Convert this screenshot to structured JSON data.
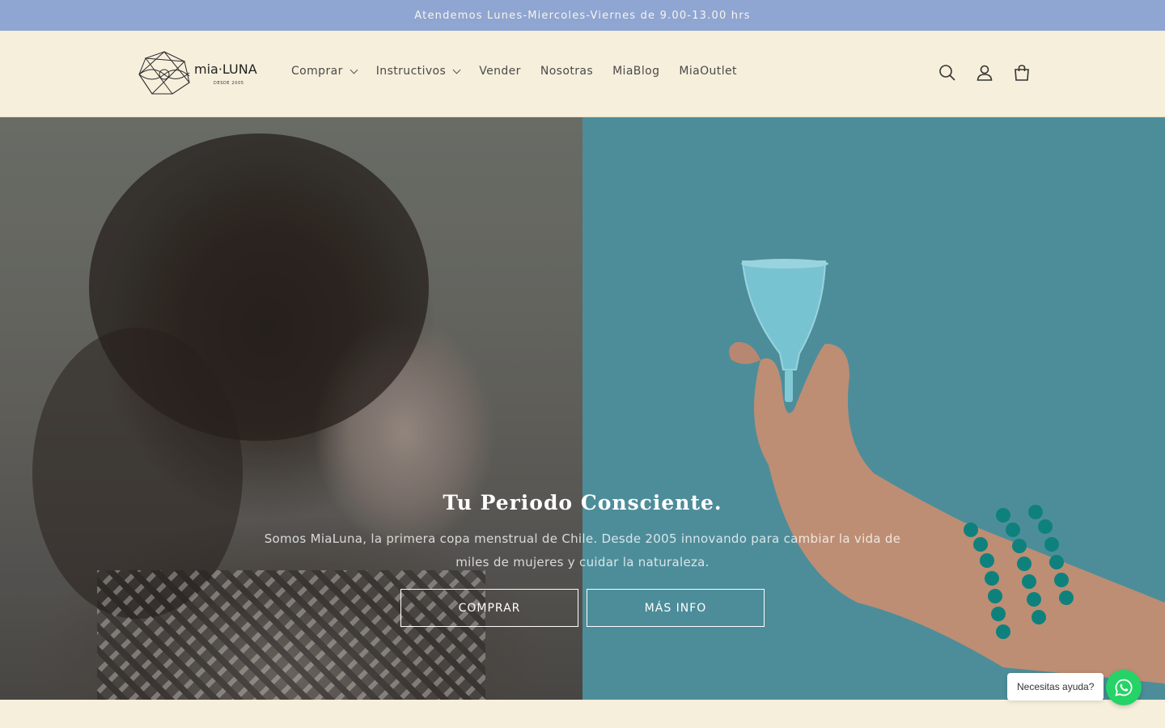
{
  "announcement": {
    "text": "Atendemos Lunes-Miercoles-Viernes de 9.00-13.00 hrs"
  },
  "header": {
    "logo": {
      "text": "mia·LUNA",
      "tagline": "DESDE 2005"
    },
    "nav": [
      {
        "label": "Comprar",
        "has_dropdown": true
      },
      {
        "label": "Instructivos",
        "has_dropdown": true
      },
      {
        "label": "Vender",
        "has_dropdown": false
      },
      {
        "label": "Nosotras",
        "has_dropdown": false
      },
      {
        "label": "MiaBlog",
        "has_dropdown": false
      },
      {
        "label": "MiaOutlet",
        "has_dropdown": false
      }
    ],
    "icons": [
      "search-icon",
      "account-icon",
      "cart-icon"
    ]
  },
  "hero": {
    "title": "Tu Periodo Consciente.",
    "subtitle": "Somos MiaLuna, la primera copa menstrual de Chile. Desde 2005 innovando para cambiar la vida de miles de mujeres y cuidar la naturaleza.",
    "buttons": [
      {
        "label": "COMPRAR"
      },
      {
        "label": "MÁS INFO"
      }
    ],
    "colors": {
      "right_panel": "#5296a4",
      "announcement_bar": "#8fa5d2",
      "background": "#f6efdc"
    }
  },
  "whatsapp": {
    "label": "Necesitas ayuda?"
  }
}
